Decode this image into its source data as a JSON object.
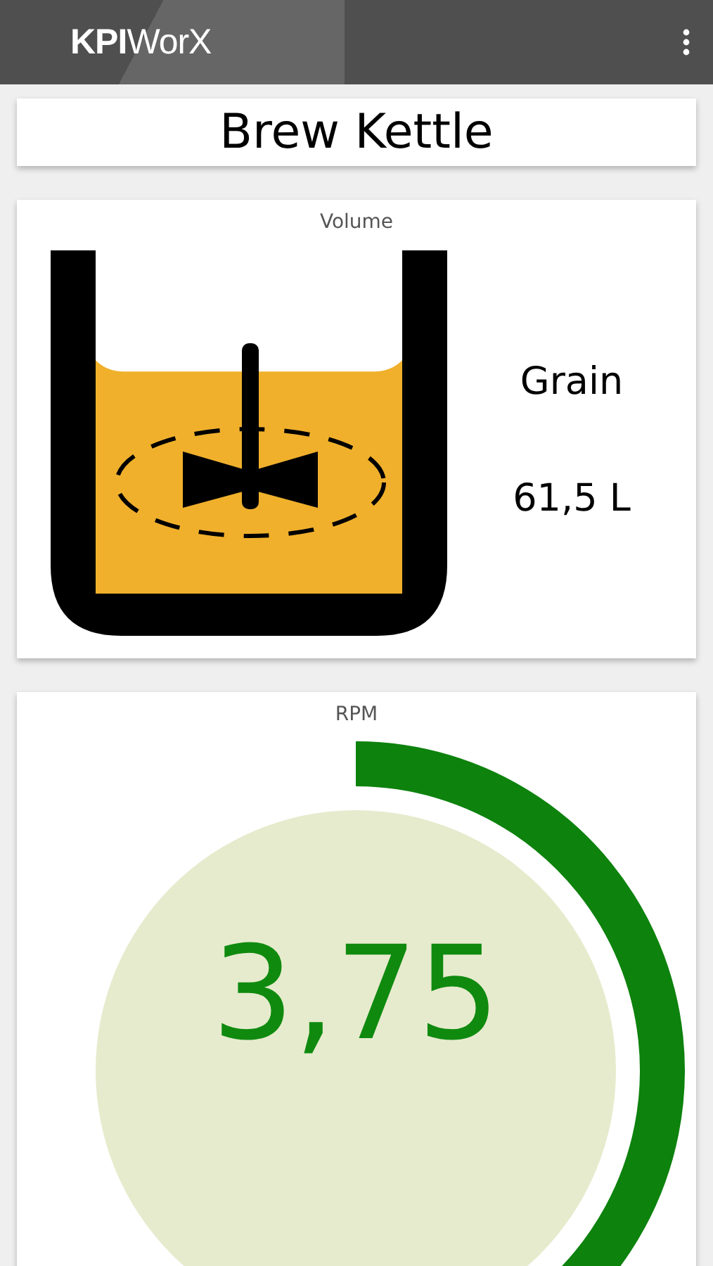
{
  "app_bar": {
    "logo": "**KPI**WorX"
  },
  "title": "Brew Kettle",
  "volume_card": {
    "title": "Volume",
    "material": "Grain",
    "reading": "61,5 L"
  },
  "rpm_card": {
    "title": "RPM",
    "value": "3,75"
  }
}
